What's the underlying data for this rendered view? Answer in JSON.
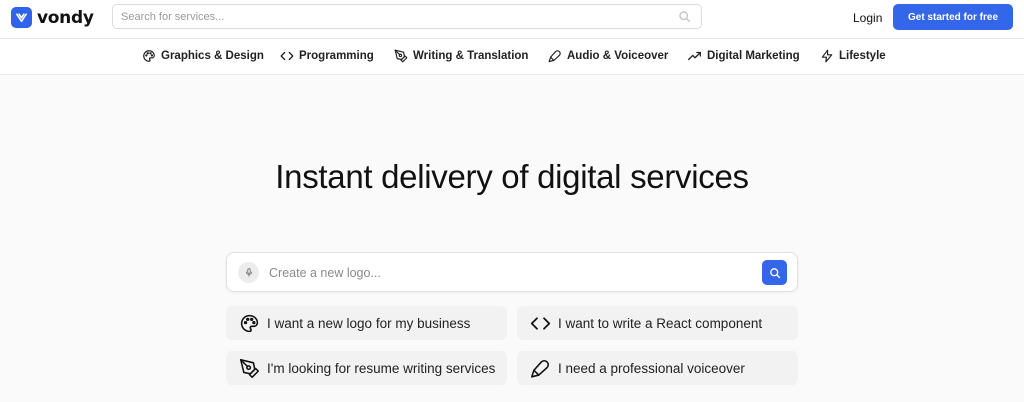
{
  "header": {
    "logo_text": "vondy",
    "search_placeholder": "Search for services...",
    "login_label": "Login",
    "cta_label": "Get started for free",
    "accent_color": "#3366e8"
  },
  "categories": [
    {
      "label": "Graphics & Design",
      "icon": "palette-icon"
    },
    {
      "label": "Programming",
      "icon": "code-icon"
    },
    {
      "label": "Writing & Translation",
      "icon": "pen-nib-icon"
    },
    {
      "label": "Audio & Voiceover",
      "icon": "microphone-icon"
    },
    {
      "label": "Digital Marketing",
      "icon": "trending-up-icon"
    },
    {
      "label": "Lifestyle",
      "icon": "lightning-icon"
    }
  ],
  "hero": {
    "title": "Instant delivery of digital services",
    "search_placeholder": "Create a new logo..."
  },
  "suggestions": [
    {
      "label": "I want a new logo for my business",
      "icon": "palette-icon"
    },
    {
      "label": "I want to write a React component",
      "icon": "code-icon"
    },
    {
      "label": "I'm looking for resume writing services",
      "icon": "pen-nib-icon"
    },
    {
      "label": "I need a professional voiceover",
      "icon": "microphone-icon"
    }
  ]
}
